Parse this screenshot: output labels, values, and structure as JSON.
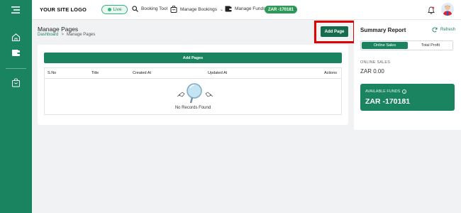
{
  "header": {
    "logo": "YOUR SITE LOGO",
    "live_label": "Live",
    "nav": [
      {
        "label": "Booking Tool",
        "icon": "search-icon"
      },
      {
        "label": "Manage Bookings",
        "icon": "bag-icon"
      },
      {
        "label": "Manage Funds",
        "icon": "wallet-icon"
      }
    ],
    "funds_badge": "ZAR -170181",
    "notifications_icon": "bell-icon"
  },
  "sidebar": {
    "items": [
      {
        "icon": "home-icon"
      },
      {
        "icon": "wallet-icon"
      },
      {
        "icon": "bag-icon"
      }
    ]
  },
  "page": {
    "title": "Manage Pages",
    "breadcrumb": {
      "home": "Dashboard",
      "separator": ">",
      "current": "Manage Pages"
    },
    "add_page_button": "Add Page",
    "add_pages_bar": "Add Pages",
    "table": {
      "columns": [
        "S.No",
        "Title",
        "Created At",
        "Updated At",
        "Actions"
      ],
      "empty_text": "No Records Found"
    }
  },
  "summary": {
    "title": "Summary Report",
    "refresh": "Refresh",
    "tabs": [
      "Online Sales",
      "Total Profit"
    ],
    "active_tab": "Online Sales",
    "online_sales_label": "ONLINE SALES",
    "online_sales_value": "ZAR 0.00",
    "available_funds_label": "AVAILABLE FUNDS",
    "available_funds_value": "ZAR -170181"
  },
  "colors": {
    "brand": "#1a8461",
    "highlight": "#e30000"
  }
}
